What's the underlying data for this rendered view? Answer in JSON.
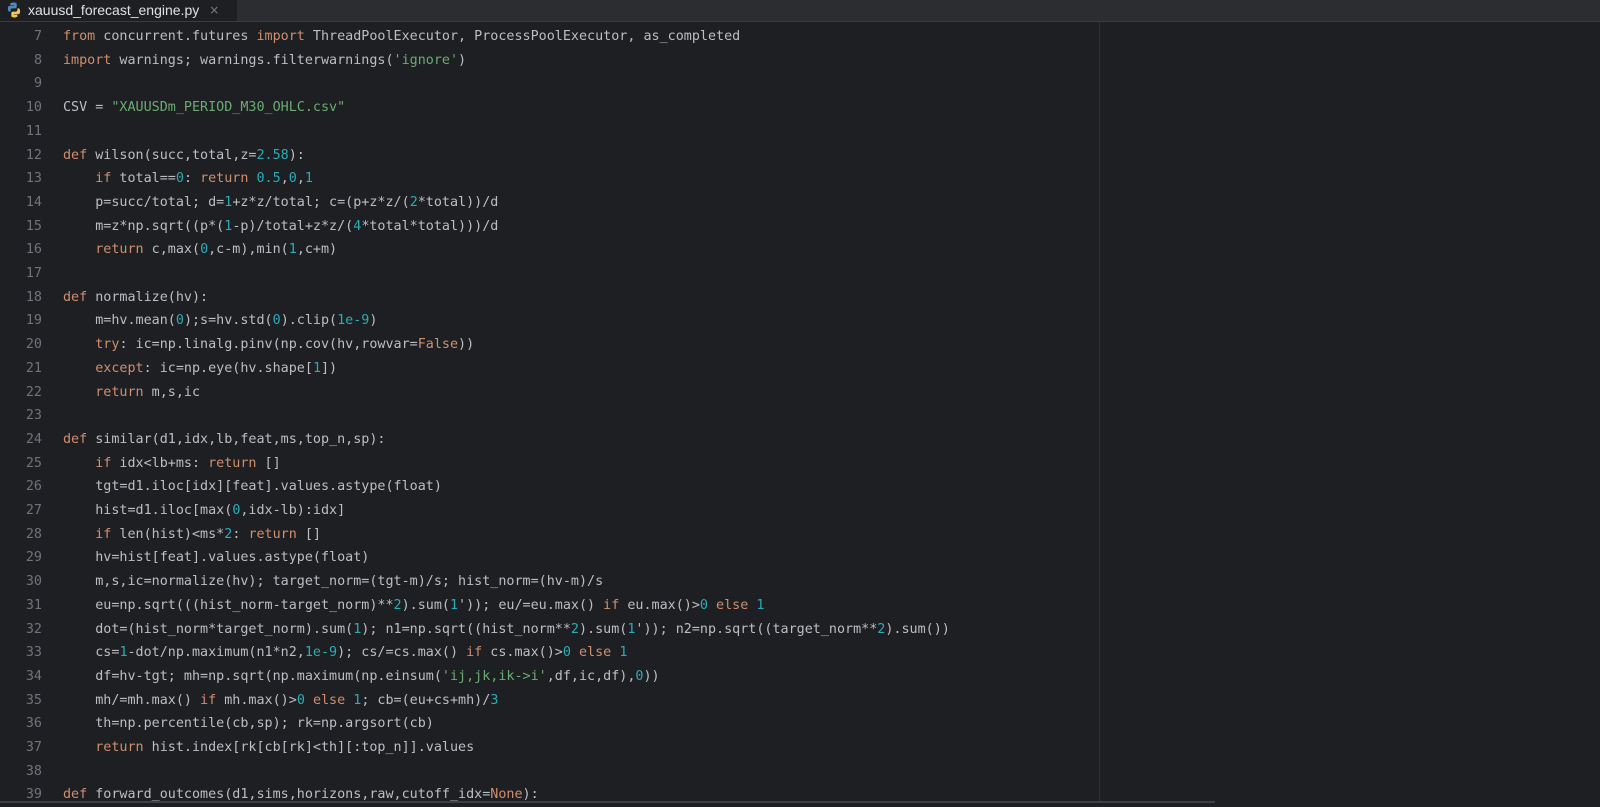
{
  "tab": {
    "filename": "xauusd_forecast_engine.py",
    "close_glyph": "×",
    "icon": "python-icon"
  },
  "colors": {
    "keyword": "#cf8e6d",
    "number": "#2aacb8",
    "string": "#6aab73",
    "text": "#bcbec4",
    "line_number": "#6f737a",
    "background": "#1e1f22"
  },
  "lines": [
    {
      "n": "7",
      "tokens": [
        [
          "kw",
          "from"
        ],
        [
          "t",
          " concurrent.futures "
        ],
        [
          "kw",
          "import"
        ],
        [
          "t",
          " ThreadPoolExecutor, ProcessPoolExecutor, as_completed"
        ]
      ]
    },
    {
      "n": "8",
      "tokens": [
        [
          "kw",
          "import"
        ],
        [
          "t",
          " warnings; warnings.filterwarnings("
        ],
        [
          "str",
          "'ignore'"
        ],
        [
          "t",
          ")"
        ]
      ]
    },
    {
      "n": "9",
      "tokens": []
    },
    {
      "n": "10",
      "tokens": [
        [
          "t",
          "CSV = "
        ],
        [
          "str",
          "\"XAUUSDm_PERIOD_M30_OHLC.csv\""
        ]
      ]
    },
    {
      "n": "11",
      "tokens": []
    },
    {
      "n": "12",
      "tokens": [
        [
          "kw",
          "def"
        ],
        [
          "t",
          " wilson(succ,total,z="
        ],
        [
          "num",
          "2.58"
        ],
        [
          "t",
          "):"
        ]
      ]
    },
    {
      "n": "13",
      "tokens": [
        [
          "t",
          "    "
        ],
        [
          "kw",
          "if"
        ],
        [
          "t",
          " total=="
        ],
        [
          "num",
          "0"
        ],
        [
          "t",
          ": "
        ],
        [
          "kw",
          "return"
        ],
        [
          "t",
          " "
        ],
        [
          "num",
          "0.5"
        ],
        [
          "t",
          ","
        ],
        [
          "num",
          "0"
        ],
        [
          "t",
          ","
        ],
        [
          "num",
          "1"
        ]
      ]
    },
    {
      "n": "14",
      "tokens": [
        [
          "t",
          "    p=succ/total; d="
        ],
        [
          "num",
          "1"
        ],
        [
          "t",
          "+z*z/total; c=(p+z*z/("
        ],
        [
          "num",
          "2"
        ],
        [
          "t",
          "*total))/d"
        ]
      ]
    },
    {
      "n": "15",
      "tokens": [
        [
          "t",
          "    m=z*np.sqrt((p*("
        ],
        [
          "num",
          "1"
        ],
        [
          "t",
          "-p)/total+z*z/("
        ],
        [
          "num",
          "4"
        ],
        [
          "t",
          "*total*total)))/d"
        ]
      ]
    },
    {
      "n": "16",
      "tokens": [
        [
          "t",
          "    "
        ],
        [
          "kw",
          "return"
        ],
        [
          "t",
          " c,max("
        ],
        [
          "num",
          "0"
        ],
        [
          "t",
          ",c-m),min("
        ],
        [
          "num",
          "1"
        ],
        [
          "t",
          ",c+m)"
        ]
      ]
    },
    {
      "n": "17",
      "tokens": []
    },
    {
      "n": "18",
      "tokens": [
        [
          "kw",
          "def"
        ],
        [
          "t",
          " normalize(hv):"
        ]
      ]
    },
    {
      "n": "19",
      "tokens": [
        [
          "t",
          "    m=hv.mean("
        ],
        [
          "num",
          "0"
        ],
        [
          "t",
          ");s=hv.std("
        ],
        [
          "num",
          "0"
        ],
        [
          "t",
          ").clip("
        ],
        [
          "num",
          "1e-9"
        ],
        [
          "t",
          ")"
        ]
      ]
    },
    {
      "n": "20",
      "tokens": [
        [
          "t",
          "    "
        ],
        [
          "kw",
          "try"
        ],
        [
          "t",
          ": ic=np.linalg.pinv(np.cov(hv,rowvar="
        ],
        [
          "kw",
          "False"
        ],
        [
          "t",
          "))"
        ]
      ]
    },
    {
      "n": "21",
      "tokens": [
        [
          "t",
          "    "
        ],
        [
          "kw",
          "except"
        ],
        [
          "t",
          ": ic=np.eye(hv.shape["
        ],
        [
          "num",
          "1"
        ],
        [
          "t",
          "])"
        ]
      ]
    },
    {
      "n": "22",
      "tokens": [
        [
          "t",
          "    "
        ],
        [
          "kw",
          "return"
        ],
        [
          "t",
          " m,s,ic"
        ]
      ]
    },
    {
      "n": "23",
      "tokens": []
    },
    {
      "n": "24",
      "tokens": [
        [
          "kw",
          "def"
        ],
        [
          "t",
          " similar(d1,idx,lb,feat,ms,top_n,sp):"
        ]
      ]
    },
    {
      "n": "25",
      "tokens": [
        [
          "t",
          "    "
        ],
        [
          "kw",
          "if"
        ],
        [
          "t",
          " idx<lb+ms: "
        ],
        [
          "kw",
          "return"
        ],
        [
          "t",
          " []"
        ]
      ]
    },
    {
      "n": "26",
      "tokens": [
        [
          "t",
          "    tgt=d1.iloc[idx][feat].values.astype(float)"
        ]
      ]
    },
    {
      "n": "27",
      "tokens": [
        [
          "t",
          "    hist=d1.iloc[max("
        ],
        [
          "num",
          "0"
        ],
        [
          "t",
          ",idx-lb):idx]"
        ]
      ]
    },
    {
      "n": "28",
      "tokens": [
        [
          "t",
          "    "
        ],
        [
          "kw",
          "if"
        ],
        [
          "t",
          " len(hist)<ms*"
        ],
        [
          "num",
          "2"
        ],
        [
          "t",
          ": "
        ],
        [
          "kw",
          "return"
        ],
        [
          "t",
          " []"
        ]
      ]
    },
    {
      "n": "29",
      "tokens": [
        [
          "t",
          "    hv=hist[feat].values.astype(float)"
        ]
      ]
    },
    {
      "n": "30",
      "tokens": [
        [
          "t",
          "    m,s,ic=normalize(hv); target_norm=(tgt-m)/s; hist_norm=(hv-m)/s"
        ]
      ]
    },
    {
      "n": "31",
      "tokens": [
        [
          "t",
          "    eu=np.sqrt(((hist_norm-target_norm)**"
        ],
        [
          "num",
          "2"
        ],
        [
          "t",
          ").sum("
        ],
        [
          "num",
          "1"
        ],
        [
          "t",
          "')); eu/=eu.max() "
        ],
        [
          "kw",
          "if"
        ],
        [
          "t",
          " eu.max()>"
        ],
        [
          "num",
          "0"
        ],
        [
          "t",
          " "
        ],
        [
          "kw",
          "else"
        ],
        [
          "t",
          " "
        ],
        [
          "num",
          "1"
        ]
      ]
    },
    {
      "n": "32",
      "tokens": [
        [
          "t",
          "    dot=(hist_norm*target_norm).sum("
        ],
        [
          "num",
          "1"
        ],
        [
          "t",
          "); n1=np.sqrt((hist_norm**"
        ],
        [
          "num",
          "2"
        ],
        [
          "t",
          ").sum("
        ],
        [
          "num",
          "1"
        ],
        [
          "t",
          "')); n2=np.sqrt((target_norm**"
        ],
        [
          "num",
          "2"
        ],
        [
          "t",
          ").sum())"
        ]
      ]
    },
    {
      "n": "33",
      "tokens": [
        [
          "t",
          "    cs="
        ],
        [
          "num",
          "1"
        ],
        [
          "t",
          "-dot/np.maximum(n1*n2,"
        ],
        [
          "num",
          "1e-9"
        ],
        [
          "t",
          "); cs/=cs.max() "
        ],
        [
          "kw",
          "if"
        ],
        [
          "t",
          " cs.max()>"
        ],
        [
          "num",
          "0"
        ],
        [
          "t",
          " "
        ],
        [
          "kw",
          "else"
        ],
        [
          "t",
          " "
        ],
        [
          "num",
          "1"
        ]
      ]
    },
    {
      "n": "34",
      "tokens": [
        [
          "t",
          "    df=hv-tgt; mh=np.sqrt(np.maximum(np.einsum("
        ],
        [
          "str",
          "'ij,jk,ik->i'"
        ],
        [
          "t",
          ",df,ic,df),"
        ],
        [
          "num",
          "0"
        ],
        [
          "t",
          "))"
        ]
      ]
    },
    {
      "n": "35",
      "tokens": [
        [
          "t",
          "    mh/=mh.max() "
        ],
        [
          "kw",
          "if"
        ],
        [
          "t",
          " mh.max()>"
        ],
        [
          "num",
          "0"
        ],
        [
          "t",
          " "
        ],
        [
          "kw",
          "else"
        ],
        [
          "t",
          " "
        ],
        [
          "num",
          "1"
        ],
        [
          "t",
          "; cb=(eu+cs+mh)/"
        ],
        [
          "num",
          "3"
        ]
      ]
    },
    {
      "n": "36",
      "tokens": [
        [
          "t",
          "    th=np.percentile(cb,sp); rk=np.argsort(cb)"
        ]
      ]
    },
    {
      "n": "37",
      "tokens": [
        [
          "t",
          "    "
        ],
        [
          "kw",
          "return"
        ],
        [
          "t",
          " hist.index[rk[cb[rk]<th][:top_n]].values"
        ]
      ]
    },
    {
      "n": "38",
      "tokens": []
    },
    {
      "n": "39",
      "tokens": [
        [
          "kw",
          "def"
        ],
        [
          "t",
          " forward_outcomes(d1,sims,horizons,raw,cutoff_idx="
        ],
        [
          "kw",
          "None"
        ],
        [
          "t",
          "):"
        ]
      ]
    }
  ]
}
